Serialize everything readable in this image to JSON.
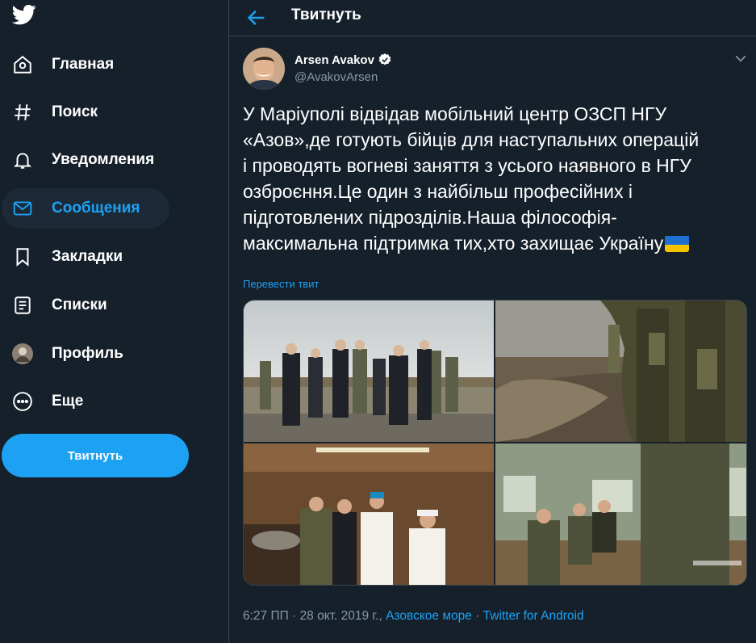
{
  "sidebar": {
    "items": [
      {
        "label": "Главная",
        "icon": "home-icon"
      },
      {
        "label": "Поиск",
        "icon": "hashtag-icon"
      },
      {
        "label": "Уведомления",
        "icon": "bell-icon"
      },
      {
        "label": "Сообщения",
        "icon": "mail-icon",
        "active": true
      },
      {
        "label": "Закладки",
        "icon": "bookmark-icon"
      },
      {
        "label": "Списки",
        "icon": "list-icon"
      },
      {
        "label": "Профиль",
        "icon": "profile-avatar-icon"
      },
      {
        "label": "Еще",
        "icon": "more-icon"
      }
    ],
    "tweet_button": "Твитнуть"
  },
  "header": {
    "title": "Твитнуть"
  },
  "tweet": {
    "author_name": "Arsen Avakov",
    "author_handle": "@AvakovArsen",
    "text_lines": [
      "У Маріуполі відвідав мобільний центр ОЗСП НГУ",
      "«Азов»,де готують бійців для наступальних операцій",
      "і проводять вогневі заняття з усього наявного в НГУ",
      "озброєння.Це один з найбільш професійних і",
      "підготовлених підрозділів.Наша філософія-",
      "максимальна підтримка тих,хто захищає Україну"
    ],
    "translate_label": "Перевести твит",
    "time_date": "6:27 ПП · 28 окт. 2019 г.,",
    "location": "Азовское море",
    "separator": "·",
    "source": "Twitter for Android"
  },
  "colors": {
    "background": "#15202b",
    "accent": "#1da1f2",
    "secondary_text": "#8899a6",
    "border": "#38444d",
    "active_bg": "#1c2a38"
  }
}
